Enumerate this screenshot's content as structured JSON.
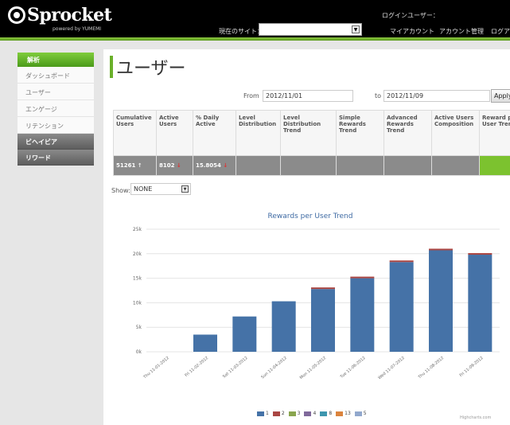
{
  "header": {
    "logo_text": "Sprocket",
    "logo_sub": "powered by YUMEMI",
    "login_label": "ログインユーザー：",
    "site_label": "現在のサイト：",
    "site_select_value": "",
    "nav": {
      "my_account": "マイアカウント",
      "account_mgmt": "アカウント管理",
      "logout": "ログア"
    }
  },
  "sidebar": {
    "section": "解析",
    "items": [
      "ダッシュボード",
      "ユーザー",
      "エンゲージ",
      "リテンション"
    ],
    "dark_items": [
      "ビヘイビア",
      "リワード"
    ]
  },
  "main": {
    "title": "ユーザー",
    "from_label": "From",
    "from_value": "2012/11/01",
    "to_label": "to",
    "to_value": "2012/11/09",
    "apply_label": "Apply",
    "show_label": "Show:",
    "show_value": "NONE"
  },
  "metrics": {
    "headers": [
      "Cumulative Users",
      "Active Users",
      "% Daily Active",
      "Level Distribution",
      "Level Distribution Trend",
      "Simple Rewards Trend",
      "Advanced Rewards Trend",
      "Active Users Composition",
      "Reward per User Trend"
    ],
    "values": [
      "51261",
      "8102",
      "15.8054",
      "",
      "",
      "",
      "",
      "",
      ""
    ],
    "trends": [
      "up",
      "down",
      "down",
      "",
      "",
      "",
      "",
      "",
      ""
    ],
    "trend_glyphs": {
      "up": "↑",
      "down": "↓"
    }
  },
  "chart_data": {
    "type": "bar",
    "title": "Rewards per User Trend",
    "categories": [
      "Thu 11-01-2012",
      "Fri 11-02-2012",
      "Sat 11-03-2012",
      "Sun 11-04-2012",
      "Mon 11-05-2012",
      "Tue 11-06-2012",
      "Wed 11-07-2012",
      "Thu 11-08-2012",
      "Fri 11-09-2012"
    ],
    "ylim": [
      0,
      25000
    ],
    "yticks": [
      "0k",
      "5k",
      "10k",
      "15k",
      "20k",
      "25k"
    ],
    "ytick_values": [
      0,
      5000,
      10000,
      15000,
      20000,
      25000
    ],
    "stacked": true,
    "series": [
      {
        "name": "1",
        "color": "#4572a7",
        "values": [
          0,
          3500,
          7200,
          10300,
          12800,
          15000,
          18300,
          20700,
          19800
        ]
      },
      {
        "name": "2",
        "color": "#aa4643",
        "values": [
          0,
          0,
          0,
          0,
          200,
          200,
          200,
          200,
          200
        ]
      },
      {
        "name": "3",
        "color": "#89a54e",
        "values": [
          0,
          0,
          0,
          0,
          0,
          0,
          0,
          0,
          0
        ]
      },
      {
        "name": "4",
        "color": "#80699b",
        "values": [
          0,
          0,
          0,
          0,
          0,
          0,
          0,
          0,
          0
        ]
      },
      {
        "name": "8",
        "color": "#3d96ae",
        "values": [
          0,
          0,
          0,
          0,
          0,
          0,
          0,
          0,
          0
        ]
      },
      {
        "name": "13",
        "color": "#db843d",
        "values": [
          0,
          0,
          0,
          0,
          0,
          0,
          0,
          0,
          0
        ]
      },
      {
        "name": "5",
        "color": "#92a8cd",
        "values": [
          0,
          0,
          0,
          0,
          0,
          0,
          0,
          0,
          0
        ]
      }
    ],
    "grid": true,
    "legend": "bottom-center",
    "credit": "Highcharts.com"
  }
}
